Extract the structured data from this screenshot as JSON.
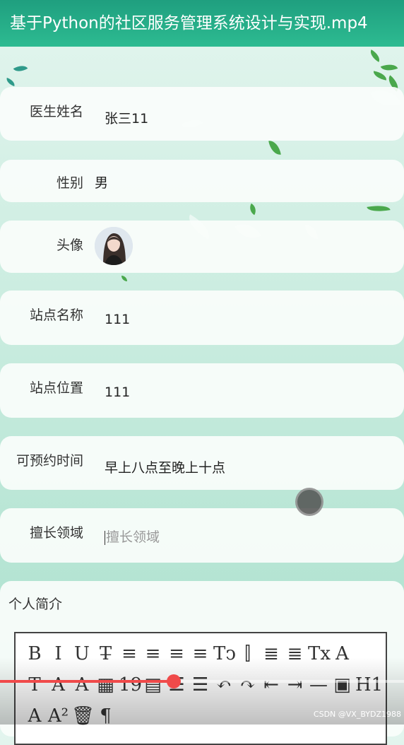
{
  "video": {
    "title": "基于Python的社区服务管理系统设计与实现.mp4",
    "watermark": "CSDN @VX_BYDZ1988",
    "progress": 0.43
  },
  "form": {
    "doctor_name": {
      "label": "医生姓名",
      "value": "张三11"
    },
    "gender": {
      "label": "性别",
      "value": "男"
    },
    "avatar": {
      "label": "头像"
    },
    "station_name": {
      "label": "站点名称",
      "value": "111"
    },
    "station_location": {
      "label": "站点位置",
      "value": "111"
    },
    "available_time": {
      "label": "可预约时间",
      "value": "早上八点至晚上十点"
    },
    "specialty": {
      "label": "擅长领域",
      "placeholder": "擅长领域"
    },
    "intro": {
      "label": "个人简介"
    }
  },
  "editor_toolbar": {
    "row1": [
      "B",
      "I",
      "U",
      "T̶",
      "≡",
      "≡",
      "≡",
      "≡",
      "Tↄ",
      "⫿",
      "≣",
      "≣",
      "Tx",
      "A"
    ],
    "row2": [
      "T",
      "A",
      "A",
      "▦",
      "19",
      "▤",
      "☰",
      "☰",
      "↶",
      "↷",
      "⇤",
      "⇥",
      "—",
      "▣",
      "H1"
    ],
    "row3": [
      "A",
      "A²",
      "🗑",
      "¶"
    ]
  },
  "colors": {
    "title_bar": "#2dbb91",
    "progress": "#f04a4a",
    "leaf": "#4aa84c"
  }
}
